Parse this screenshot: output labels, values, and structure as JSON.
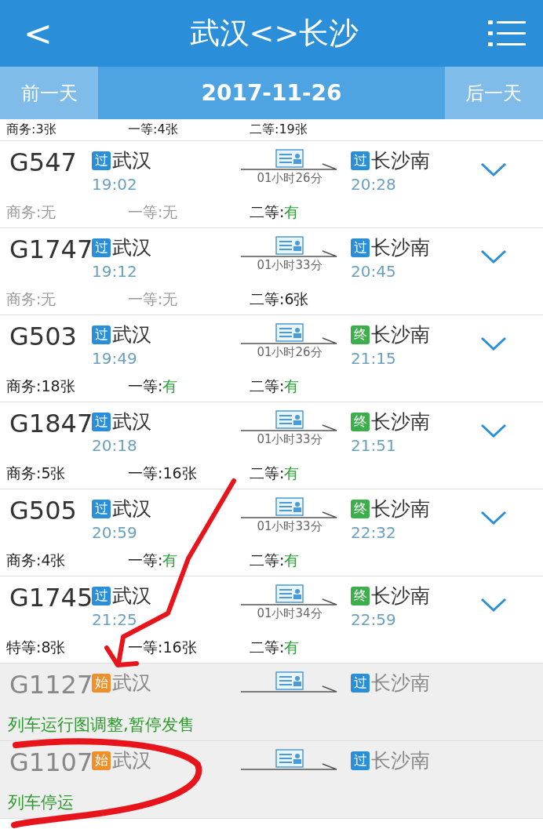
{
  "header": {
    "back": "<",
    "title": "武汉<>长沙"
  },
  "date_bar": {
    "prev": "前一天",
    "date": "2017-11-26",
    "next": "后一天"
  },
  "partial_seats": [
    {
      "label": "商务:",
      "value": "3张",
      "kind": "count"
    },
    {
      "label": "一等:",
      "value": "4张",
      "kind": "count"
    },
    {
      "label": "二等:",
      "value": "19张",
      "kind": "count"
    }
  ],
  "trains": [
    {
      "train": "G547",
      "disabled": false,
      "from_badge": {
        "text": "过",
        "kind": "pass"
      },
      "from": "武汉",
      "depart": "19:02",
      "duration": "01小时26分",
      "to_badge": {
        "text": "过",
        "kind": "pass"
      },
      "to": "长沙南",
      "arrive": "20:28",
      "seats": [
        {
          "label": "商务:",
          "value": "无",
          "kind": "none"
        },
        {
          "label": "一等:",
          "value": "无",
          "kind": "none"
        },
        {
          "label": "二等:",
          "value": "有",
          "kind": "available"
        }
      ]
    },
    {
      "train": "G1747",
      "disabled": false,
      "from_badge": {
        "text": "过",
        "kind": "pass"
      },
      "from": "武汉",
      "depart": "19:12",
      "duration": "01小时33分",
      "to_badge": {
        "text": "过",
        "kind": "pass"
      },
      "to": "长沙南",
      "arrive": "20:45",
      "seats": [
        {
          "label": "商务:",
          "value": "无",
          "kind": "none"
        },
        {
          "label": "一等:",
          "value": "无",
          "kind": "none"
        },
        {
          "label": "二等:",
          "value": "6张",
          "kind": "count"
        }
      ]
    },
    {
      "train": "G503",
      "disabled": false,
      "from_badge": {
        "text": "过",
        "kind": "pass"
      },
      "from": "武汉",
      "depart": "19:49",
      "duration": "01小时26分",
      "to_badge": {
        "text": "终",
        "kind": "end"
      },
      "to": "长沙南",
      "arrive": "21:15",
      "seats": [
        {
          "label": "商务:",
          "value": "18张",
          "kind": "count"
        },
        {
          "label": "一等:",
          "value": "有",
          "kind": "available"
        },
        {
          "label": "二等:",
          "value": "有",
          "kind": "available"
        }
      ]
    },
    {
      "train": "G1847",
      "disabled": false,
      "from_badge": {
        "text": "过",
        "kind": "pass"
      },
      "from": "武汉",
      "depart": "20:18",
      "duration": "01小时33分",
      "to_badge": {
        "text": "终",
        "kind": "end"
      },
      "to": "长沙南",
      "arrive": "21:51",
      "seats": [
        {
          "label": "商务:",
          "value": "5张",
          "kind": "count"
        },
        {
          "label": "一等:",
          "value": "16张",
          "kind": "count"
        },
        {
          "label": "二等:",
          "value": "有",
          "kind": "available"
        }
      ]
    },
    {
      "train": "G505",
      "disabled": false,
      "from_badge": {
        "text": "过",
        "kind": "pass"
      },
      "from": "武汉",
      "depart": "20:59",
      "duration": "01小时33分",
      "to_badge": {
        "text": "终",
        "kind": "end"
      },
      "to": "长沙南",
      "arrive": "22:32",
      "seats": [
        {
          "label": "商务:",
          "value": "4张",
          "kind": "count"
        },
        {
          "label": "一等:",
          "value": "有",
          "kind": "available"
        },
        {
          "label": "二等:",
          "value": "有",
          "kind": "available"
        }
      ]
    },
    {
      "train": "G1745",
      "disabled": false,
      "from_badge": {
        "text": "过",
        "kind": "pass"
      },
      "from": "武汉",
      "depart": "21:25",
      "duration": "01小时34分",
      "to_badge": {
        "text": "终",
        "kind": "end"
      },
      "to": "长沙南",
      "arrive": "22:59",
      "seats": [
        {
          "label": "特等:",
          "value": "8张",
          "kind": "count"
        },
        {
          "label": "一等:",
          "value": "16张",
          "kind": "count"
        },
        {
          "label": "二等:",
          "value": "有",
          "kind": "available"
        }
      ]
    },
    {
      "train": "G1127",
      "disabled": true,
      "from_badge": {
        "text": "始",
        "kind": "start"
      },
      "from": "武汉",
      "to_badge": {
        "text": "过",
        "kind": "pass"
      },
      "to": "长沙南",
      "note": "列车运行图调整,暂停发售"
    },
    {
      "train": "G1107",
      "disabled": true,
      "from_badge": {
        "text": "始",
        "kind": "start"
      },
      "from": "武汉",
      "to_badge": {
        "text": "过",
        "kind": "pass"
      },
      "to": "长沙南",
      "note": "列车停运"
    }
  ]
}
